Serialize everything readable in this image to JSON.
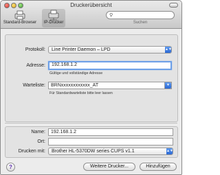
{
  "window": {
    "title": "Druckerübersicht"
  },
  "toolbar": {
    "standard_browser_label": "Standard-Browser",
    "ip_printer_label": "IP-Drucker",
    "search_label": "Suchen",
    "search_value": "",
    "search_icon": "magnifier-icon"
  },
  "form": {
    "protocol_label": "Protokoll:",
    "protocol_value": "Line Printer Daemon – LPD",
    "address_label": "Adresse:",
    "address_value": "192.168.1.2",
    "address_hint": "Gültige und vollständige Adresse",
    "queue_label": "Warteliste:",
    "queue_value": "BRNxxxxxxxxxxxx_AT",
    "queue_hint": "Für Standardwarteliste bitte leer lassen"
  },
  "details": {
    "name_label": "Name:",
    "name_value": "192.168.1.2",
    "location_label": "Ort:",
    "location_value": "",
    "print_with_label": "Drucken mit:",
    "print_with_value": "Brother HL-5370DW series CUPS v1.1"
  },
  "buttons": {
    "help": "?",
    "more_printers": "Weitere Drucker...",
    "add": "Hinzufügen"
  },
  "colors": {
    "accent": "#3a78dc",
    "focus_ring": "#6da0e8"
  }
}
